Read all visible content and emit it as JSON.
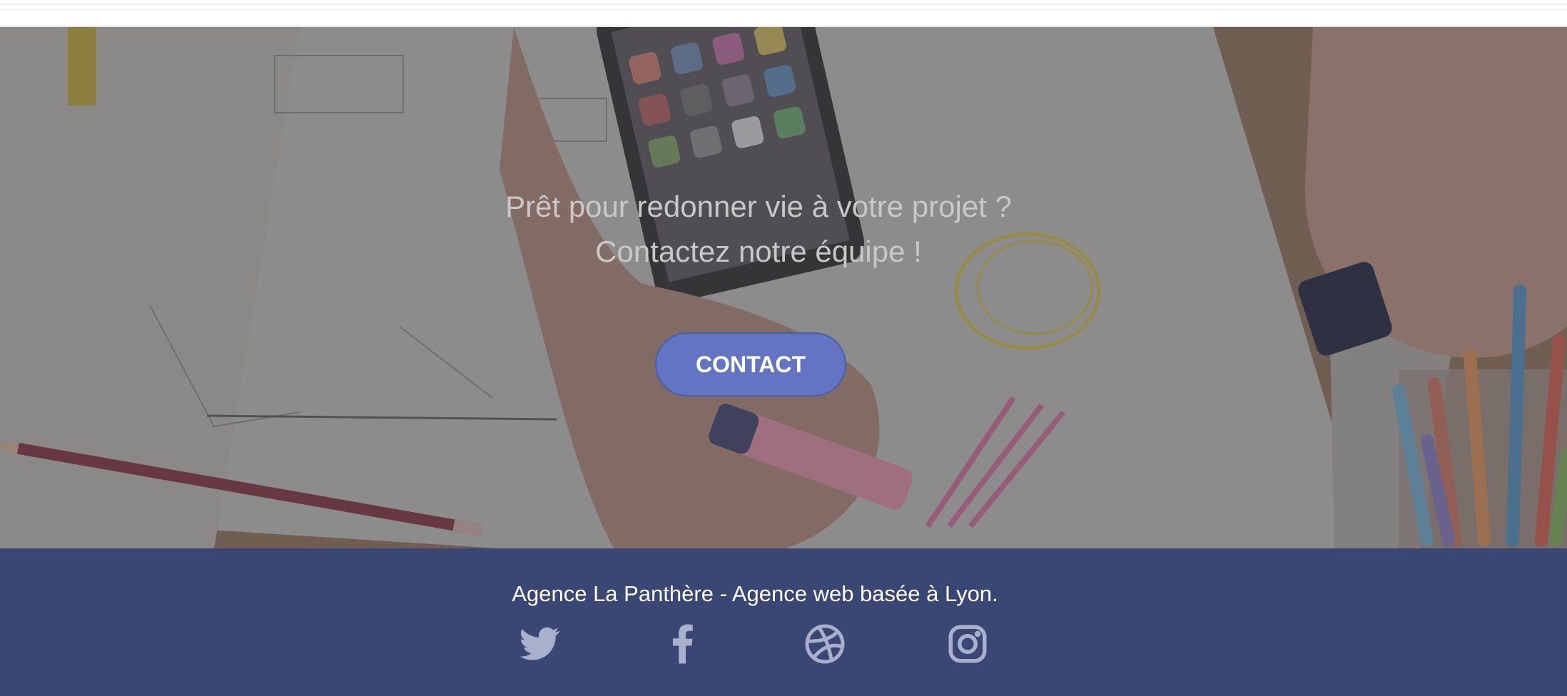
{
  "hero": {
    "heading_line1": "Prêt pour redonner vie à votre projet ?",
    "heading_line2": "Contactez notre équipe !",
    "contact_label": "CONTACT"
  },
  "footer": {
    "tagline": "Agence La Panthère - Agence web basée à Lyon.",
    "social": [
      {
        "name": "twitter-icon"
      },
      {
        "name": "facebook-icon"
      },
      {
        "name": "dribbble-icon"
      },
      {
        "name": "instagram-icon"
      }
    ]
  },
  "colors": {
    "footer_bg": "#3a4774",
    "button_bg": "#6274c2",
    "icon_color": "#a9b0cc",
    "heading_color": "#c9c7c8"
  }
}
